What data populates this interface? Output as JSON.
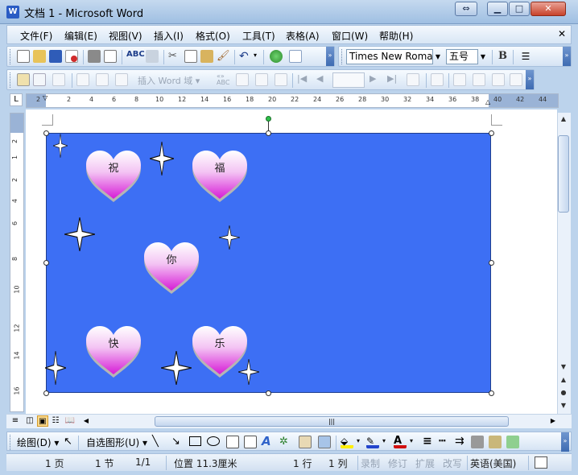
{
  "window": {
    "title": "文档 1 - Microsoft Word",
    "app_icon": "W"
  },
  "menu": [
    "文件(F)",
    "编辑(E)",
    "视图(V)",
    "插入(I)",
    "格式(O)",
    "工具(T)",
    "表格(A)",
    "窗口(W)",
    "帮助(H)"
  ],
  "formatting": {
    "font": "Times New Roman",
    "size": "五号",
    "bold": "B"
  },
  "toolbar2": {
    "insert_field_label": "插入 Word 域 ▾"
  },
  "ruler": {
    "h_ticks": [
      "2",
      "2",
      "4",
      "6",
      "8",
      "10",
      "12",
      "14",
      "16",
      "18",
      "20",
      "22",
      "24",
      "26",
      "28",
      "30",
      "32",
      "34",
      "36",
      "38",
      "40",
      "42",
      "44"
    ],
    "v_ticks": [
      "2",
      "1",
      "2",
      "4",
      "6",
      "8",
      "10",
      "12",
      "14",
      "16"
    ]
  },
  "canvas": {
    "background": "#3d6ff4",
    "hearts": [
      {
        "label": "祝"
      },
      {
        "label": "福"
      },
      {
        "label": "你"
      },
      {
        "label": "快"
      },
      {
        "label": "乐"
      }
    ]
  },
  "drawing_bar": {
    "draw_label": "绘图(D) ▾",
    "autoshapes_label": "自选图形(U) ▾"
  },
  "status": {
    "page": "1 页",
    "section": "1 节",
    "page_of": "1/1",
    "position": "位置 11.3厘米",
    "line": "1 行",
    "col": "1 列",
    "rec": "录制",
    "trk": "修订",
    "ext": "扩展",
    "ovr": "改写",
    "language": "英语(美国)"
  }
}
